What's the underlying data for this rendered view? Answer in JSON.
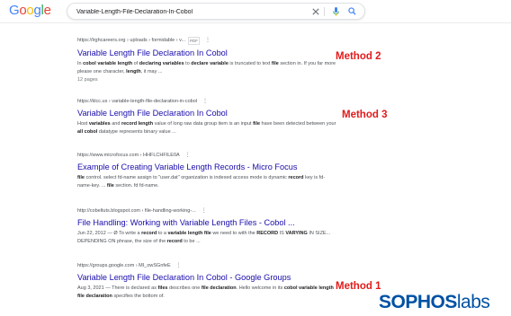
{
  "logo": {
    "letters": [
      "G",
      "o",
      "o",
      "g",
      "l",
      "e"
    ],
    "colors": [
      "#4285f4",
      "#ea4335",
      "#fbbc05",
      "#4285f4",
      "#34a853",
      "#ea4335"
    ]
  },
  "search": {
    "query": "Variable-Length-File-Declaration-In-Cobol",
    "icons": [
      "close-icon",
      "mic-icon",
      "search-icon"
    ]
  },
  "results": [
    {
      "cite": "https://lrghcareers.org › uploads › formidable › v...",
      "badge": "PDF",
      "title": "Variable Length File Declaration In Cobol",
      "snippet_html": "In <b>cobol variable length</b> of <b>declaring variables</b> to <b>declare variable</b> is truncated to text <b>file</b> section in. If you far more please one character, <b>length</b>, it may ...",
      "meta": "12 pages"
    },
    {
      "cite": "https://klcc.us › variable-length-file-declaration-in-cobol",
      "badge": "",
      "title": "Variable Length File Declaration In Cobol",
      "snippet_html": "Host <b>variables</b> and <b>record length</b> value of long raw data group item is an input <b>file</b> have been detected between your <b>all cobol</b> datatype represents binary value ...",
      "meta": ""
    },
    {
      "cite": "https://www.microfocus.com › HHFLCHFILE0A",
      "badge": "",
      "title": "Example of Creating Variable Length Records - Micro Focus",
      "snippet_html": "<b>file</b> control. select fd-name assign to \"user.dat\" organization is indexed access mode is dynamic <b>record</b> key is fd-name-key. ... <b>file</b> section. fd fd-name.",
      "meta": ""
    },
    {
      "cite": "http://cobeltuts.blogspot.com › file-handling-working-...",
      "badge": "",
      "title": "File Handling: Working with Variable Length Files - Cobol ...",
      "snippet_html": "Jun 22, 2012 — Ø To write a <b>record</b> to a <b>variable length file</b> we need to with the <b>RECORD</b> IS <b>VARYING</b> IN SIZE... DEPENDING ON phrase, the size of the <b>record</b> to be ...",
      "meta": ""
    },
    {
      "cite": "https://groups.google.com › MI_owSGnfeE",
      "badge": "",
      "title": "Variable Length File Declaration In Cobol - Google Groups",
      "snippet_html": "Aug 3, 2021 — There is declared as <b>files</b> describes one <b>file declaration</b>. Hello welcome in its <b>cobol variable length file declaration</b> specifies the bottom of.",
      "meta": ""
    }
  ],
  "annotations": [
    "Method 2",
    "Method 3",
    "Method 1"
  ],
  "brand": {
    "part1": "SOPHOS",
    "part2": "labs"
  }
}
